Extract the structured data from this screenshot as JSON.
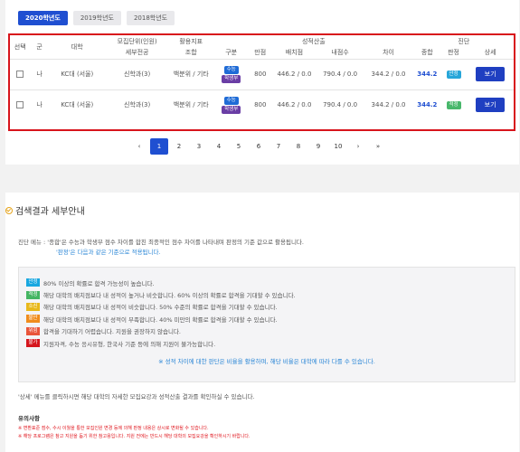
{
  "year_tabs": [
    "2020학년도",
    "2019학년도",
    "2018학년도"
  ],
  "table": {
    "headers_top": {
      "select": "선택",
      "gun": "군",
      "univ": "대학",
      "recruit": "모집단위(인원)",
      "indicator": "활용지표",
      "score_calc": "성적산출",
      "verdict": "진단"
    },
    "headers_sub": {
      "recruit": "세부전공",
      "indicator": "조합",
      "type": "구분",
      "full": "만점",
      "conv": "배치점",
      "mine": "내점수",
      "diff": "차이",
      "total": "종합",
      "judge": "판정",
      "detail": "상세"
    },
    "rows": [
      {
        "gun": "나",
        "univ": "KC대 (서울)",
        "recruit": "신학과(3)",
        "indicator": "백분위 / 기타",
        "tag1": "수능",
        "tag2": "학생부",
        "full": "800",
        "conv": "446.2 / 0.0",
        "mine": "790.4 / 0.0",
        "diff": "344.2 / 0.0",
        "total": "344.2",
        "judge": "안정",
        "detail_btn": "보기"
      },
      {
        "gun": "나",
        "univ": "KC대 (서울)",
        "recruit": "신학과(3)",
        "indicator": "백분위 / 기타",
        "tag1": "수능",
        "tag2": "학생부",
        "full": "800",
        "conv": "446.2 / 0.0",
        "mine": "790.4 / 0.0",
        "diff": "344.2 / 0.0",
        "total": "344.2",
        "judge": "적정",
        "detail_btn": "보기"
      }
    ]
  },
  "pager": {
    "prev": "‹",
    "next": "›",
    "last": "»",
    "pages": [
      "1",
      "2",
      "3",
      "4",
      "5",
      "6",
      "7",
      "8",
      "9",
      "10"
    ],
    "current": "1"
  },
  "section": {
    "title": "검색결과 세부안내",
    "intro_line1": "진단 메뉴 : '종합'은 수능과 학생부 점수 차이를 합친 최종적인 점수 차이를 나타내며 판정의 기준 값으로 활용됩니다.",
    "intro_line2": "'판정'은 다음과 같은 기준으로 적용됩니다.",
    "legend": [
      {
        "tag": "안정",
        "color": "#19a7e0",
        "text": "80% 이상의 확률로 합격 가능성이 높습니다."
      },
      {
        "tag": "적정",
        "color": "#44b563",
        "text": "해당 대학의 배치점보다 내 성적이 높거나 비슷합니다. 60% 이상의 확률로 합격을 기대할 수 있습니다."
      },
      {
        "tag": "소신",
        "color": "#e8b81b",
        "text": "해당 대학의 배치점보다 내 성적이 비슷합니다. 50% 수준의 확률로 합격을 기대할 수 있습니다."
      },
      {
        "tag": "불안",
        "color": "#f08c1c",
        "text": "해당 대학의 배치점보다 내 성적이 부족합니다. 40% 미만의 확률로 합격을 기대할 수 있습니다."
      },
      {
        "tag": "위험",
        "color": "#e9543a",
        "text": "합격을 기대하기 어렵습니다. 지원을 권장하지 않습니다."
      },
      {
        "tag": "불가",
        "color": "#d5151d",
        "text": "지원자격, 수능 응시유형, 한국사 기준 등에 의해 지원이 불가능합니다."
      }
    ],
    "legend_note": "※ 성적 차이에 대한 판단은 비율을 활용하며, 해당 비율은 대학에 따라 다를 수 있습니다.",
    "detail_note": "'상세' 메뉴를 클릭하시면 해당 대학의 자세한 모집요강과 성적산출 결과를 확인하실 수 있습니다.",
    "caution_title": "유의사항",
    "cautions": [
      "※ 변환표준 점수, 수시 이월을 통한 모집인원 변경 등에 의해 판정 내용은 상시로 변화될 수 있습니다.",
      "※ 해당 프로그램은 참고 지원을 돕기 위한 참고용입니다. 지원 전에는 반드시 해당 대학의 모집요강을 확인하시기 바랍니다."
    ]
  }
}
